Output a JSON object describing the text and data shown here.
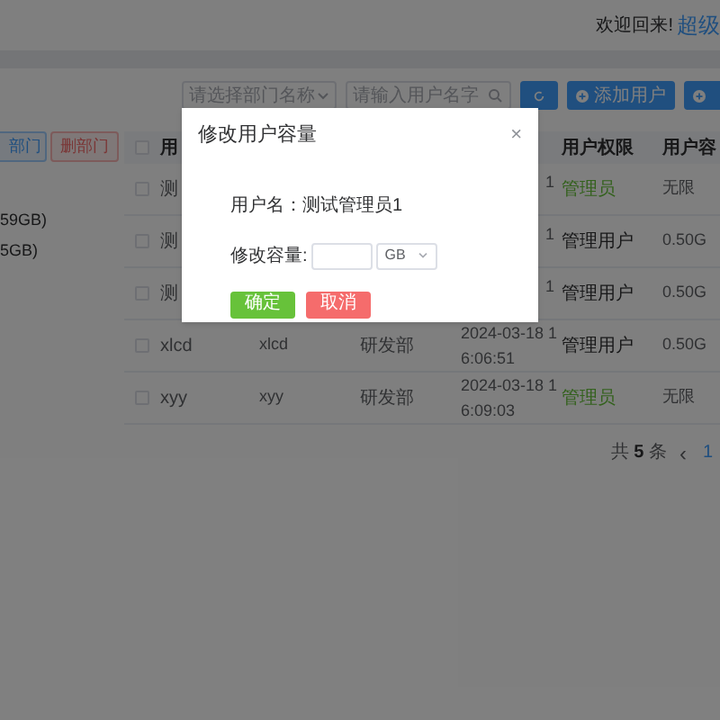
{
  "header": {
    "greeting": "欢迎回来!",
    "user": "超级"
  },
  "toolbar": {
    "department_select": {
      "placeholder": "请选择部门名称"
    },
    "search_field": {
      "placeholder": "请输入用户名字"
    },
    "add_button": "添加用户"
  },
  "department_buttons": [
    {
      "label": "部门",
      "kind": "primary"
    },
    {
      "label": "删部门",
      "kind": "danger"
    }
  ],
  "department_tree": [
    "59GB)",
    "5GB)"
  ],
  "table": {
    "select_all": {
      "checked": false
    },
    "columns": [
      "用",
      "用户权限",
      "用户容"
    ],
    "rows": [
      {
        "checked": false,
        "username": "测",
        "name": "",
        "department": "",
        "created": "1",
        "created_2": "",
        "role": "管理员",
        "kind": "admin",
        "capacity": "无限"
      },
      {
        "checked": false,
        "username": "测",
        "name": "",
        "department": "",
        "created": "1",
        "created_2": "",
        "role": "管理用户",
        "kind": "user",
        "capacity": "0.50G"
      },
      {
        "checked": false,
        "username": "测",
        "name": "",
        "department": "",
        "created": "1",
        "created_2": "",
        "role": "管理用户",
        "kind": "user",
        "capacity": "0.50G"
      },
      {
        "checked": false,
        "username": "xlcd",
        "name": "xlcd",
        "department": "研发部",
        "created": "2024-03-18 1",
        "created_2": "6:06:51",
        "role": "管理用户",
        "kind": "user",
        "capacity": "0.50G"
      },
      {
        "checked": false,
        "username": "xyy",
        "name": "xyy",
        "department": "研发部",
        "created": "2024-03-18 1",
        "created_2": "6:09:03",
        "role": "管理员",
        "kind": "admin",
        "capacity": "无限"
      }
    ]
  },
  "pagination": {
    "total_prefix": "共",
    "total": "5",
    "total_suffix": "条",
    "prev": "‹",
    "page": "1"
  },
  "dialog": {
    "title": "修改用户容量",
    "close": "×",
    "username_line": "用户名：测试管理员1",
    "capacity_label": "修改容量:",
    "unit": "GB",
    "confirm": "确定",
    "cancel": "取消"
  }
}
